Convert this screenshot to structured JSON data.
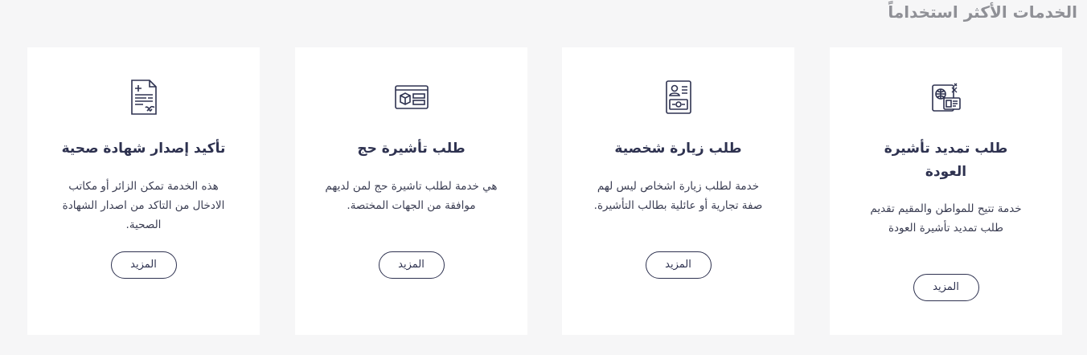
{
  "section": {
    "title": "الخدمات الأكثر استخداماً"
  },
  "cards": [
    {
      "title": "طلب تمديد تأشيرة العودة",
      "description": "خدمة تتيح للمواطن والمقيم تقديم طلب تمديد تأشيرة العودة",
      "button": "المزيد",
      "icon": "passport-visa-icon"
    },
    {
      "title": "طلب زيارة شخصية",
      "description": "خدمة لطلب زيارة اشخاص ليس لهم صفة تجارية أو عائلية بطالب التأشيرة.",
      "button": "المزيد",
      "icon": "id-document-icon"
    },
    {
      "title": "طلب تأشيرة حج",
      "description": "هي خدمة لطلب تاشيرة حج لمن لديهم موافقة من الجهات المختصة.",
      "button": "المزيد",
      "icon": "kaaba-card-icon"
    },
    {
      "title": "تأكيد إصدار شهادة صحية",
      "description": "هذه الخدمة تمكن الزائر أو مكاتب الادخال من التاكد من اصدار الشهادة الصحية.",
      "button": "المزيد",
      "icon": "health-certificate-icon"
    }
  ]
}
